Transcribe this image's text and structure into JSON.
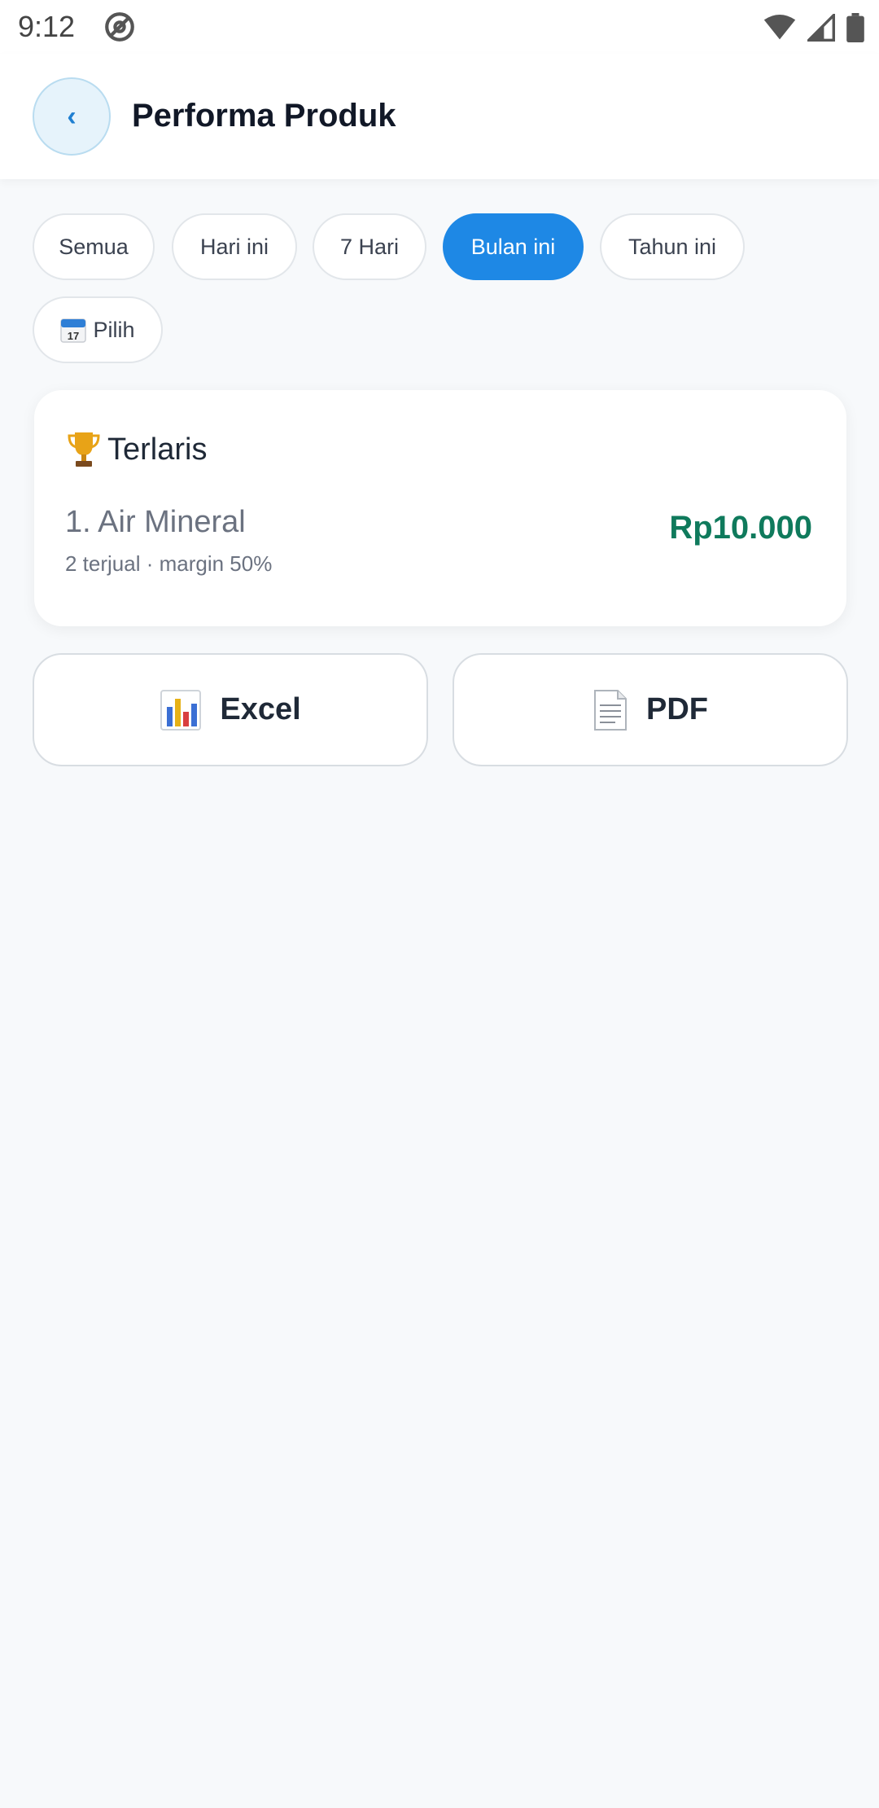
{
  "status_bar": {
    "time": "9:12"
  },
  "header": {
    "back_glyph": "‹",
    "title": "Performa Produk"
  },
  "filters": [
    {
      "label": "Semua",
      "active": false
    },
    {
      "label": "Hari ini",
      "active": false
    },
    {
      "label": "7 Hari",
      "active": false
    },
    {
      "label": "Bulan ini",
      "active": true
    },
    {
      "label": "Tahun ini",
      "active": false
    },
    {
      "label": "Pilih",
      "active": false,
      "icon": "calendar-icon"
    }
  ],
  "top_sellers": {
    "title": "Terlaris",
    "icon": "trophy-icon",
    "items": [
      {
        "name": "1. Air Mineral",
        "meta": "2 terjual · margin 50%",
        "value": "Rp10.000"
      }
    ]
  },
  "export": {
    "excel_label": "Excel",
    "excel_icon": "bar-chart-icon",
    "pdf_label": "PDF",
    "pdf_icon": "document-icon"
  },
  "colors": {
    "accent": "#1e88e5",
    "value_green": "#0f7a5c",
    "background": "#f7f9fb"
  }
}
